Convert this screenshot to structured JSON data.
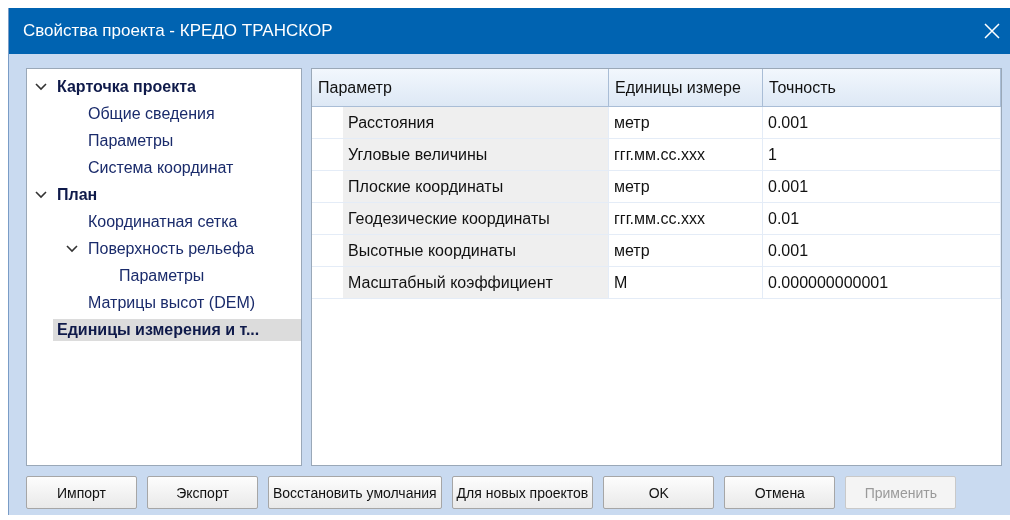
{
  "window": {
    "title": "Свойства проекта - КРЕДО ТРАНСКОР"
  },
  "tree": [
    {
      "label": "Карточка проекта",
      "expanded": true,
      "selected": false,
      "children": [
        {
          "label": "Общие сведения",
          "selected": false
        },
        {
          "label": "Параметры",
          "selected": false
        },
        {
          "label": "Система координат",
          "selected": false
        }
      ]
    },
    {
      "label": "План",
      "expanded": true,
      "selected": false,
      "children": [
        {
          "label": "Координатная сетка",
          "selected": false
        },
        {
          "label": "Поверхность рельефа",
          "expanded": true,
          "selected": false,
          "children": [
            {
              "label": "Параметры",
              "selected": false
            }
          ]
        },
        {
          "label": "Матрицы высот (DEM)",
          "selected": false
        }
      ]
    },
    {
      "label": "Единицы измерения и т...",
      "selected": true
    }
  ],
  "table": {
    "columns": [
      "Параметр",
      "Единицы измере",
      "Точность"
    ],
    "rows": [
      [
        "Расстояния",
        "метр",
        "0.001"
      ],
      [
        "Угловые величины",
        "ггг.мм.сс.ххх",
        "1"
      ],
      [
        "Плоские координаты",
        "метр",
        "0.001"
      ],
      [
        "Геодезические координаты",
        "ггг.мм.сс.ххх",
        "0.01"
      ],
      [
        "Высотные координаты",
        "метр",
        "0.001"
      ],
      [
        "Масштабный коэффициент",
        "М",
        "0.000000000001"
      ]
    ]
  },
  "buttons": [
    {
      "label": "Импорт",
      "disabled": false
    },
    {
      "label": "Экспорт",
      "disabled": false
    },
    {
      "label": "Восстановить умолчания",
      "disabled": false
    },
    {
      "label": "Для новых проектов",
      "disabled": false
    },
    {
      "label": "OK",
      "disabled": false
    },
    {
      "label": "Отмена",
      "disabled": false
    },
    {
      "label": "Применить",
      "disabled": true
    }
  ]
}
